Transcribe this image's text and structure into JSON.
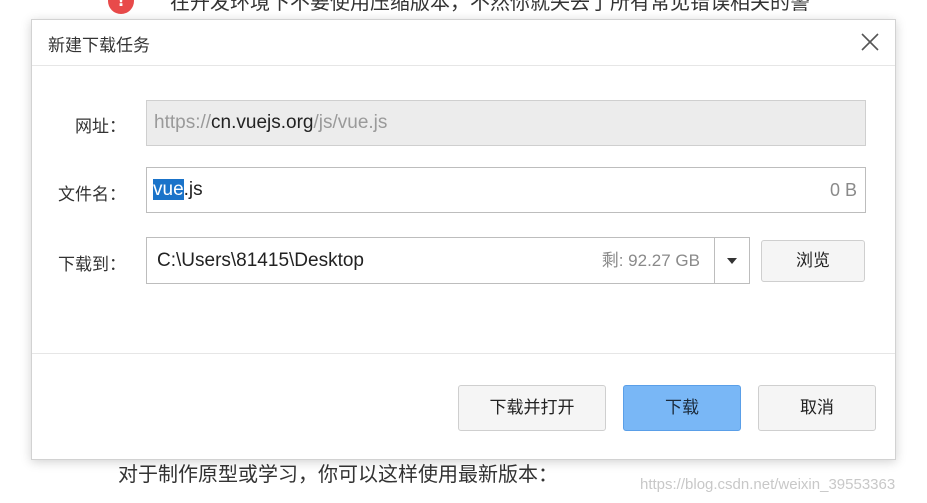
{
  "background": {
    "top_text": "在开发环境下不要使用压缩版本，不然你就失去了所有常见错误相关的警",
    "alert_icon_glyph": "!",
    "bottom_text": "对于制作原型或学习，你可以这样使用最新版本：",
    "watermark": "https://blog.csdn.net/weixin_39553363"
  },
  "dialog": {
    "title": "新建下载任务",
    "close_icon": "close-icon",
    "url": {
      "label": "网址：",
      "prefix": "https://",
      "host": "cn.vuejs.org",
      "path": "/js/vue.js"
    },
    "filename": {
      "label": "文件名：",
      "selected_part": "vue",
      "rest": ".js",
      "size": "0 B"
    },
    "destination": {
      "label": "下载到：",
      "path": "C:\\Users\\81415\\Desktop",
      "free_space": "剩: 92.27 GB",
      "dropdown_icon": "caret-down-icon"
    },
    "browse_label": "浏览",
    "buttons": {
      "download_and_open": "下载并打开",
      "download": "下载",
      "cancel": "取消"
    },
    "colors": {
      "primary_button": "#79b7f6",
      "selection": "#1a73c9"
    }
  }
}
